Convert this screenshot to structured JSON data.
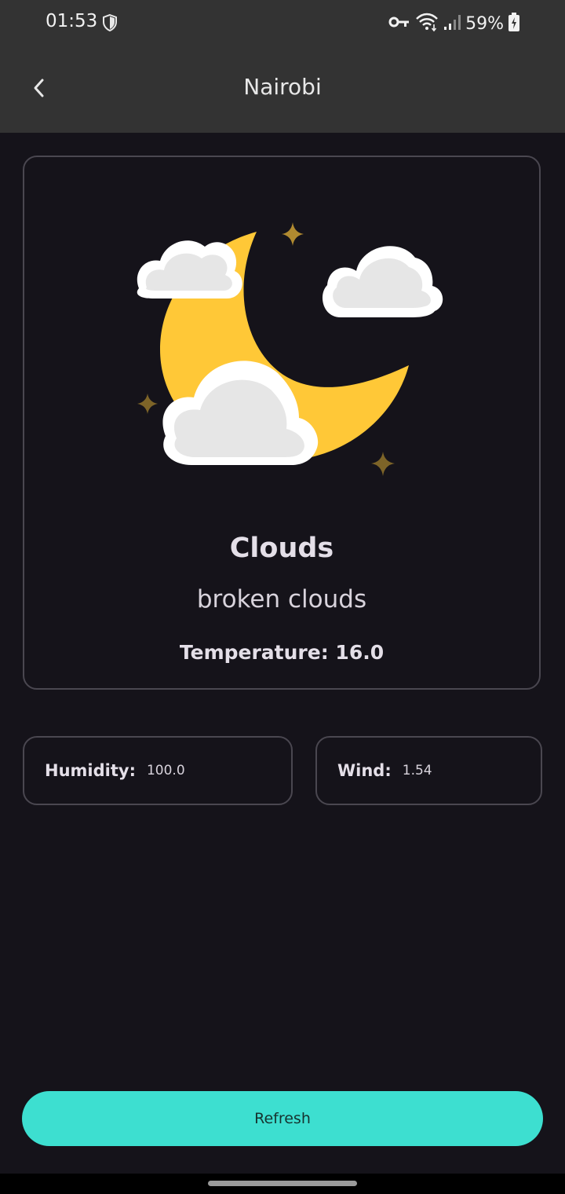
{
  "status_bar": {
    "time": "01:53",
    "battery": "59%",
    "icons": [
      "shield-icon",
      "key-icon",
      "wifi-icon",
      "signal-icon",
      "battery-charging-icon"
    ]
  },
  "app_bar": {
    "title": "Nairobi",
    "back_icon": "chevron-left-icon"
  },
  "weather": {
    "icon": "moon-with-clouds-icon",
    "main": "Clouds",
    "description": "broken clouds",
    "temperature_label": "Temperature:",
    "temperature_value": "16.0"
  },
  "humidity": {
    "label": "Humidity:",
    "value": "100.0"
  },
  "wind": {
    "label": "Wind:",
    "value": "1.54"
  },
  "refresh_button": {
    "label": "Refresh"
  },
  "colors": {
    "background": "#15131a",
    "app_bar": "#333333",
    "accent": "#3ddfd0",
    "moon": "#ffc837",
    "star": "#9a7a2e",
    "cloud": "#e6e6e6"
  }
}
